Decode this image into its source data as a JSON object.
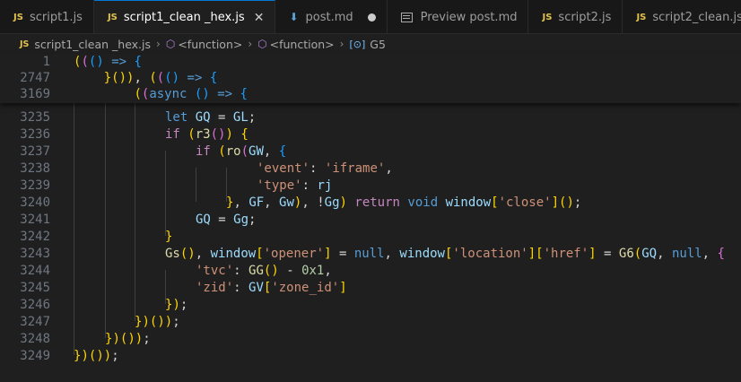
{
  "tabs": [
    {
      "label": "script1.js",
      "icon": "js-icon",
      "kind": "js"
    },
    {
      "label": "script1_clean _hex.js",
      "icon": "js-icon",
      "kind": "js",
      "active": true
    },
    {
      "label": "post.md",
      "icon": "markdown-icon",
      "kind": "md",
      "modified": true
    },
    {
      "label": "Preview post.md",
      "icon": "preview-icon",
      "kind": "preview"
    },
    {
      "label": "script2.js",
      "icon": "js-icon",
      "kind": "js"
    },
    {
      "label": "script2_clean.js",
      "icon": "js-icon",
      "kind": "js"
    }
  ],
  "icons": {
    "js_badge": "JS",
    "close": "✕"
  },
  "breadcrumb": {
    "file": "script1_clean _hex.js",
    "crumb1": "<function>",
    "crumb2": "<function>",
    "crumb3": "G5"
  },
  "sticky_lines": {
    "l1": {
      "num": "1",
      "text": "((() => {"
    },
    "l2": {
      "num": "2747",
      "text": "    }()), ((() => {"
    },
    "l3": {
      "num": "3169",
      "text": "        ((async () => {"
    }
  },
  "code_lines": [
    {
      "num": "3235",
      "text": "let GQ = GL;"
    },
    {
      "num": "3236",
      "text": "if (r3()) {"
    },
    {
      "num": "3237",
      "text": "if (ro(GW, {"
    },
    {
      "num": "3238",
      "text": "'event': 'iframe',"
    },
    {
      "num": "3239",
      "text": "'type': rj"
    },
    {
      "num": "3240",
      "text": "}, GF, Gw), !Gg) return void window['close']();"
    },
    {
      "num": "3241",
      "text": "GQ = Gg;"
    },
    {
      "num": "3242",
      "text": "}"
    },
    {
      "num": "3243",
      "text": "Gs(), window['opener'] = null, window['location']['href'] = G6(GQ, null, {"
    },
    {
      "num": "3244",
      "text": "'tvc': GG() - 0x1,"
    },
    {
      "num": "3245",
      "text": "'zid': GV['zone_id']"
    },
    {
      "num": "3246",
      "text": "});"
    },
    {
      "num": "3247",
      "text": "})());"
    },
    {
      "num": "3248",
      "text": "})());"
    },
    {
      "num": "3249",
      "text": "})());"
    }
  ],
  "colors": {
    "accent": "#0078d4",
    "js_badge": "#e3c34c",
    "background": "#1f1f1f"
  }
}
